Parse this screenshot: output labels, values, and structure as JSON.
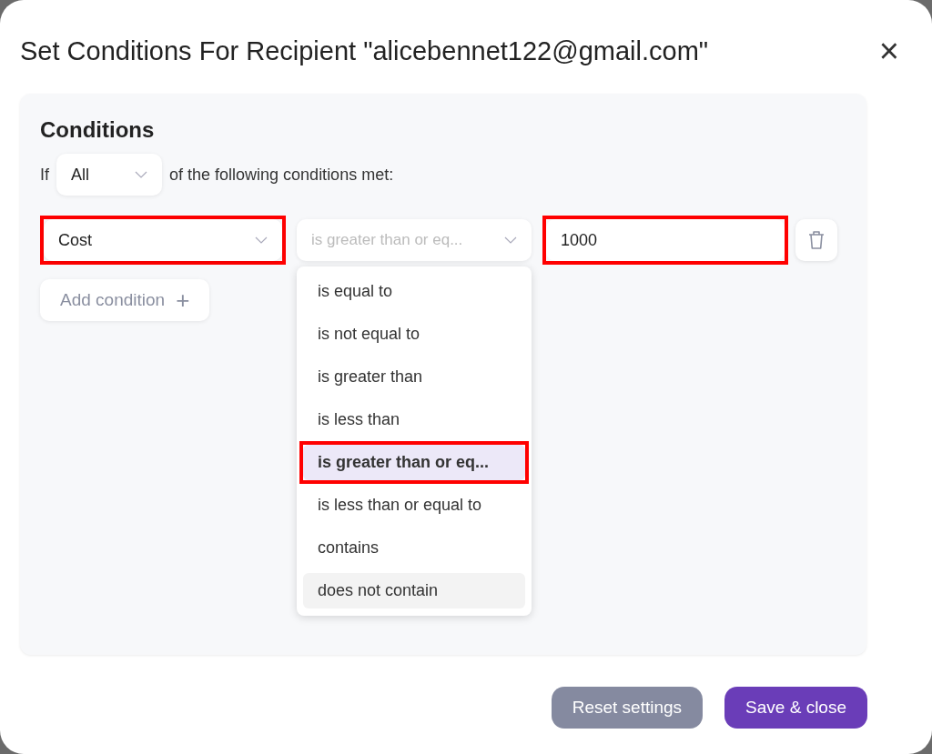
{
  "dialog": {
    "title": "Set Conditions For Recipient \"alicebennet122@gmail.com\"",
    "close": "×"
  },
  "conditions": {
    "heading": "Conditions",
    "prefix": "If",
    "match": "All",
    "suffix": "of the following conditions met:",
    "rows": [
      {
        "field": {
          "value": "Cost",
          "highlighted": true
        },
        "operator": {
          "value": "is greater than or eq...",
          "expanded": true
        },
        "value": {
          "value": "1000",
          "highlighted": true
        }
      }
    ],
    "add_button": "Add condition",
    "add_icon": "+"
  },
  "operator_menu": [
    {
      "label": "is equal to",
      "selected": false,
      "hovered": false,
      "highlighted": false
    },
    {
      "label": "is not equal to",
      "selected": false,
      "hovered": false,
      "highlighted": false
    },
    {
      "label": "is greater than",
      "selected": false,
      "hovered": false,
      "highlighted": false
    },
    {
      "label": "is less than",
      "selected": false,
      "hovered": false,
      "highlighted": false
    },
    {
      "label": "is greater than or eq...",
      "selected": true,
      "hovered": false,
      "highlighted": true
    },
    {
      "label": "is less than or equal to",
      "selected": false,
      "hovered": false,
      "highlighted": false
    },
    {
      "label": "contains",
      "selected": false,
      "hovered": false,
      "highlighted": false
    },
    {
      "label": "does not contain",
      "selected": false,
      "hovered": true,
      "highlighted": false
    }
  ],
  "buttons": [
    {
      "label": "Reset settings",
      "kind": "secondary"
    },
    {
      "label": "Save & close",
      "kind": "primary"
    }
  ]
}
